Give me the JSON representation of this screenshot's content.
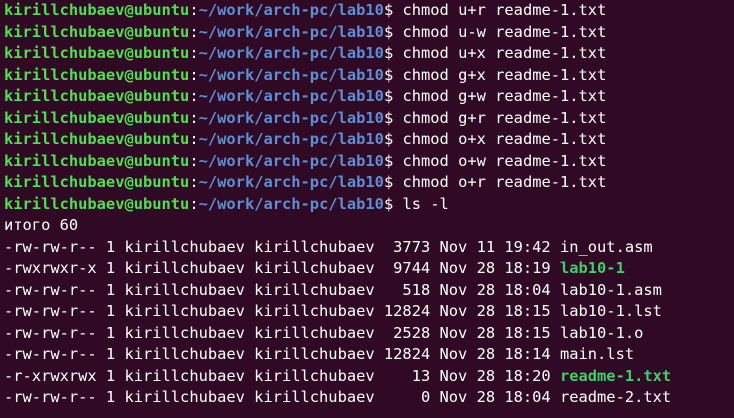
{
  "prompt": {
    "user_host": "kirillchubaev@ubuntu",
    "colon": ":",
    "path": "~/work/arch-pc/lab10",
    "dollar": "$ "
  },
  "commands": [
    "chmod u+r readme-1.txt",
    "chmod u-w readme-1.txt",
    "chmod u+x readme-1.txt",
    "chmod g+x readme-1.txt",
    "chmod g+w readme-1.txt",
    "chmod g+r readme-1.txt",
    "chmod o+x readme-1.txt",
    "chmod o+w readme-1.txt",
    "chmod o+r readme-1.txt",
    "ls -l"
  ],
  "total_line": "итого 60",
  "listing": [
    {
      "meta": "-rw-rw-r-- 1 kirillchubaev kirillchubaev  3773 Nov 11 19:42 ",
      "name": "in_out.asm"
    },
    {
      "meta": "-rwxrwxr-x 1 kirillchubaev kirillchubaev  9744 Nov 28 18:19 ",
      "name": "lab10-1"
    },
    {
      "meta": "-rw-rw-r-- 1 kirillchubaev kirillchubaev   518 Nov 28 18:04 ",
      "name": "lab10-1.asm"
    },
    {
      "meta": "-rw-rw-r-- 1 kirillchubaev kirillchubaev 12824 Nov 28 18:15 ",
      "name": "lab10-1.lst"
    },
    {
      "meta": "-rw-rw-r-- 1 kirillchubaev kirillchubaev  2528 Nov 28 18:15 ",
      "name": "lab10-1.o"
    },
    {
      "meta": "-rw-rw-r-- 1 kirillchubaev kirillchubaev 12824 Nov 28 18:14 ",
      "name": "main.lst"
    },
    {
      "meta": "-r-xrwxrwx 1 kirillchubaev kirillchubaev    13 Nov 28 18:20 ",
      "name": "readme-1.txt"
    },
    {
      "meta": "-rw-rw-r-- 1 kirillchubaev kirillchubaev     0 Nov 28 18:04 ",
      "name": "readme-2.txt"
    }
  ],
  "colors": {
    "background": "#300a24",
    "user_host": "#4ee04e",
    "path": "#5c8fd6",
    "executable": "#3fcf6b",
    "text": "#ffffff"
  }
}
